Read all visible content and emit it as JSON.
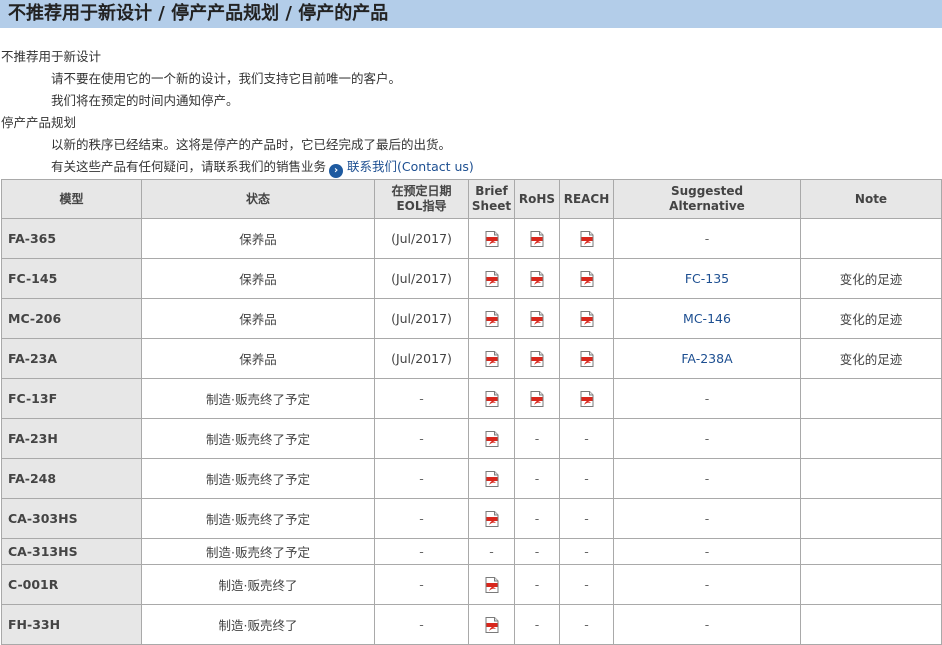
{
  "page_title": "不推荐用于新设计 / 停产产品规划 / 停产的产品",
  "notes": {
    "section1_title": "不推荐用于新设计",
    "section1_lines": [
      "请不要在使用它的一个新的设计，我们支持它目前唯一的客户。",
      "我们将在预定的时间内通知停产。"
    ],
    "section2_title": "停产产品规划",
    "section2_line1": "以新的秩序已经结束。这将是停产的产品时，它已经完成了最后的出货。",
    "section2_line2": "有关这些产品有任何疑问，请联系我们的销售业务",
    "contact_link": "联系我们(Contact us)"
  },
  "table": {
    "headers": {
      "model": "模型",
      "status": "状态",
      "eol_a": "在预定日期",
      "eol_b": "EOL指导",
      "brief_a": "Brief",
      "brief_b": "Sheet",
      "rohs": "RoHS",
      "reach": "REACH",
      "alt_a": "Suggested",
      "alt_b": "Alternative",
      "note": "Note"
    },
    "rows": [
      {
        "model": "FA-365",
        "status": "保养品",
        "eol": "(Jul/2017)",
        "brief": true,
        "rohs": true,
        "reach": true,
        "alt": "-",
        "note": ""
      },
      {
        "model": "FC-145",
        "status": "保养品",
        "eol": "(Jul/2017)",
        "brief": true,
        "rohs": true,
        "reach": true,
        "alt": "FC-135",
        "note": "变化的足迹"
      },
      {
        "model": "MC-206",
        "status": "保养品",
        "eol": "(Jul/2017)",
        "brief": true,
        "rohs": true,
        "reach": true,
        "alt": "MC-146",
        "note": "变化的足迹"
      },
      {
        "model": "FA-23A",
        "status": "保养品",
        "eol": "(Jul/2017)",
        "brief": true,
        "rohs": true,
        "reach": true,
        "alt": "FA-238A",
        "note": "变化的足迹"
      },
      {
        "model": "FC-13F",
        "status": "制造·贩売终了予定",
        "eol": "-",
        "brief": true,
        "rohs": true,
        "reach": true,
        "alt": "-",
        "note": ""
      },
      {
        "model": "FA-23H",
        "status": "制造·贩売终了予定",
        "eol": "-",
        "brief": true,
        "rohs": false,
        "reach": false,
        "alt": "-",
        "note": ""
      },
      {
        "model": "FA-248",
        "status": "制造·贩売终了予定",
        "eol": "-",
        "brief": true,
        "rohs": false,
        "reach": false,
        "alt": "-",
        "note": ""
      },
      {
        "model": "CA-303HS",
        "status": "制造·贩売终了予定",
        "eol": "-",
        "brief": true,
        "rohs": false,
        "reach": false,
        "alt": "-",
        "note": ""
      },
      {
        "model": "CA-313HS",
        "status": "制造·贩売终了予定",
        "eol": "-",
        "brief": false,
        "rohs": false,
        "reach": false,
        "alt": "-",
        "note": "",
        "short": true
      },
      {
        "model": "C-001R",
        "status": "制造·贩売终了",
        "eol": "-",
        "brief": true,
        "rohs": false,
        "reach": false,
        "alt": "-",
        "note": ""
      },
      {
        "model": "FH-33H",
        "status": "制造·贩売终了",
        "eol": "-",
        "brief": true,
        "rohs": false,
        "reach": false,
        "alt": "-",
        "note": ""
      }
    ]
  },
  "icons": {
    "pdf": "pdf-document-icon",
    "contact": "arrow-circle-icon"
  },
  "colors": {
    "title_bg": "#b3cde9",
    "header_bg": "#e7e7e7",
    "link": "#1d4f91",
    "pdf_red": "#d9261c"
  }
}
